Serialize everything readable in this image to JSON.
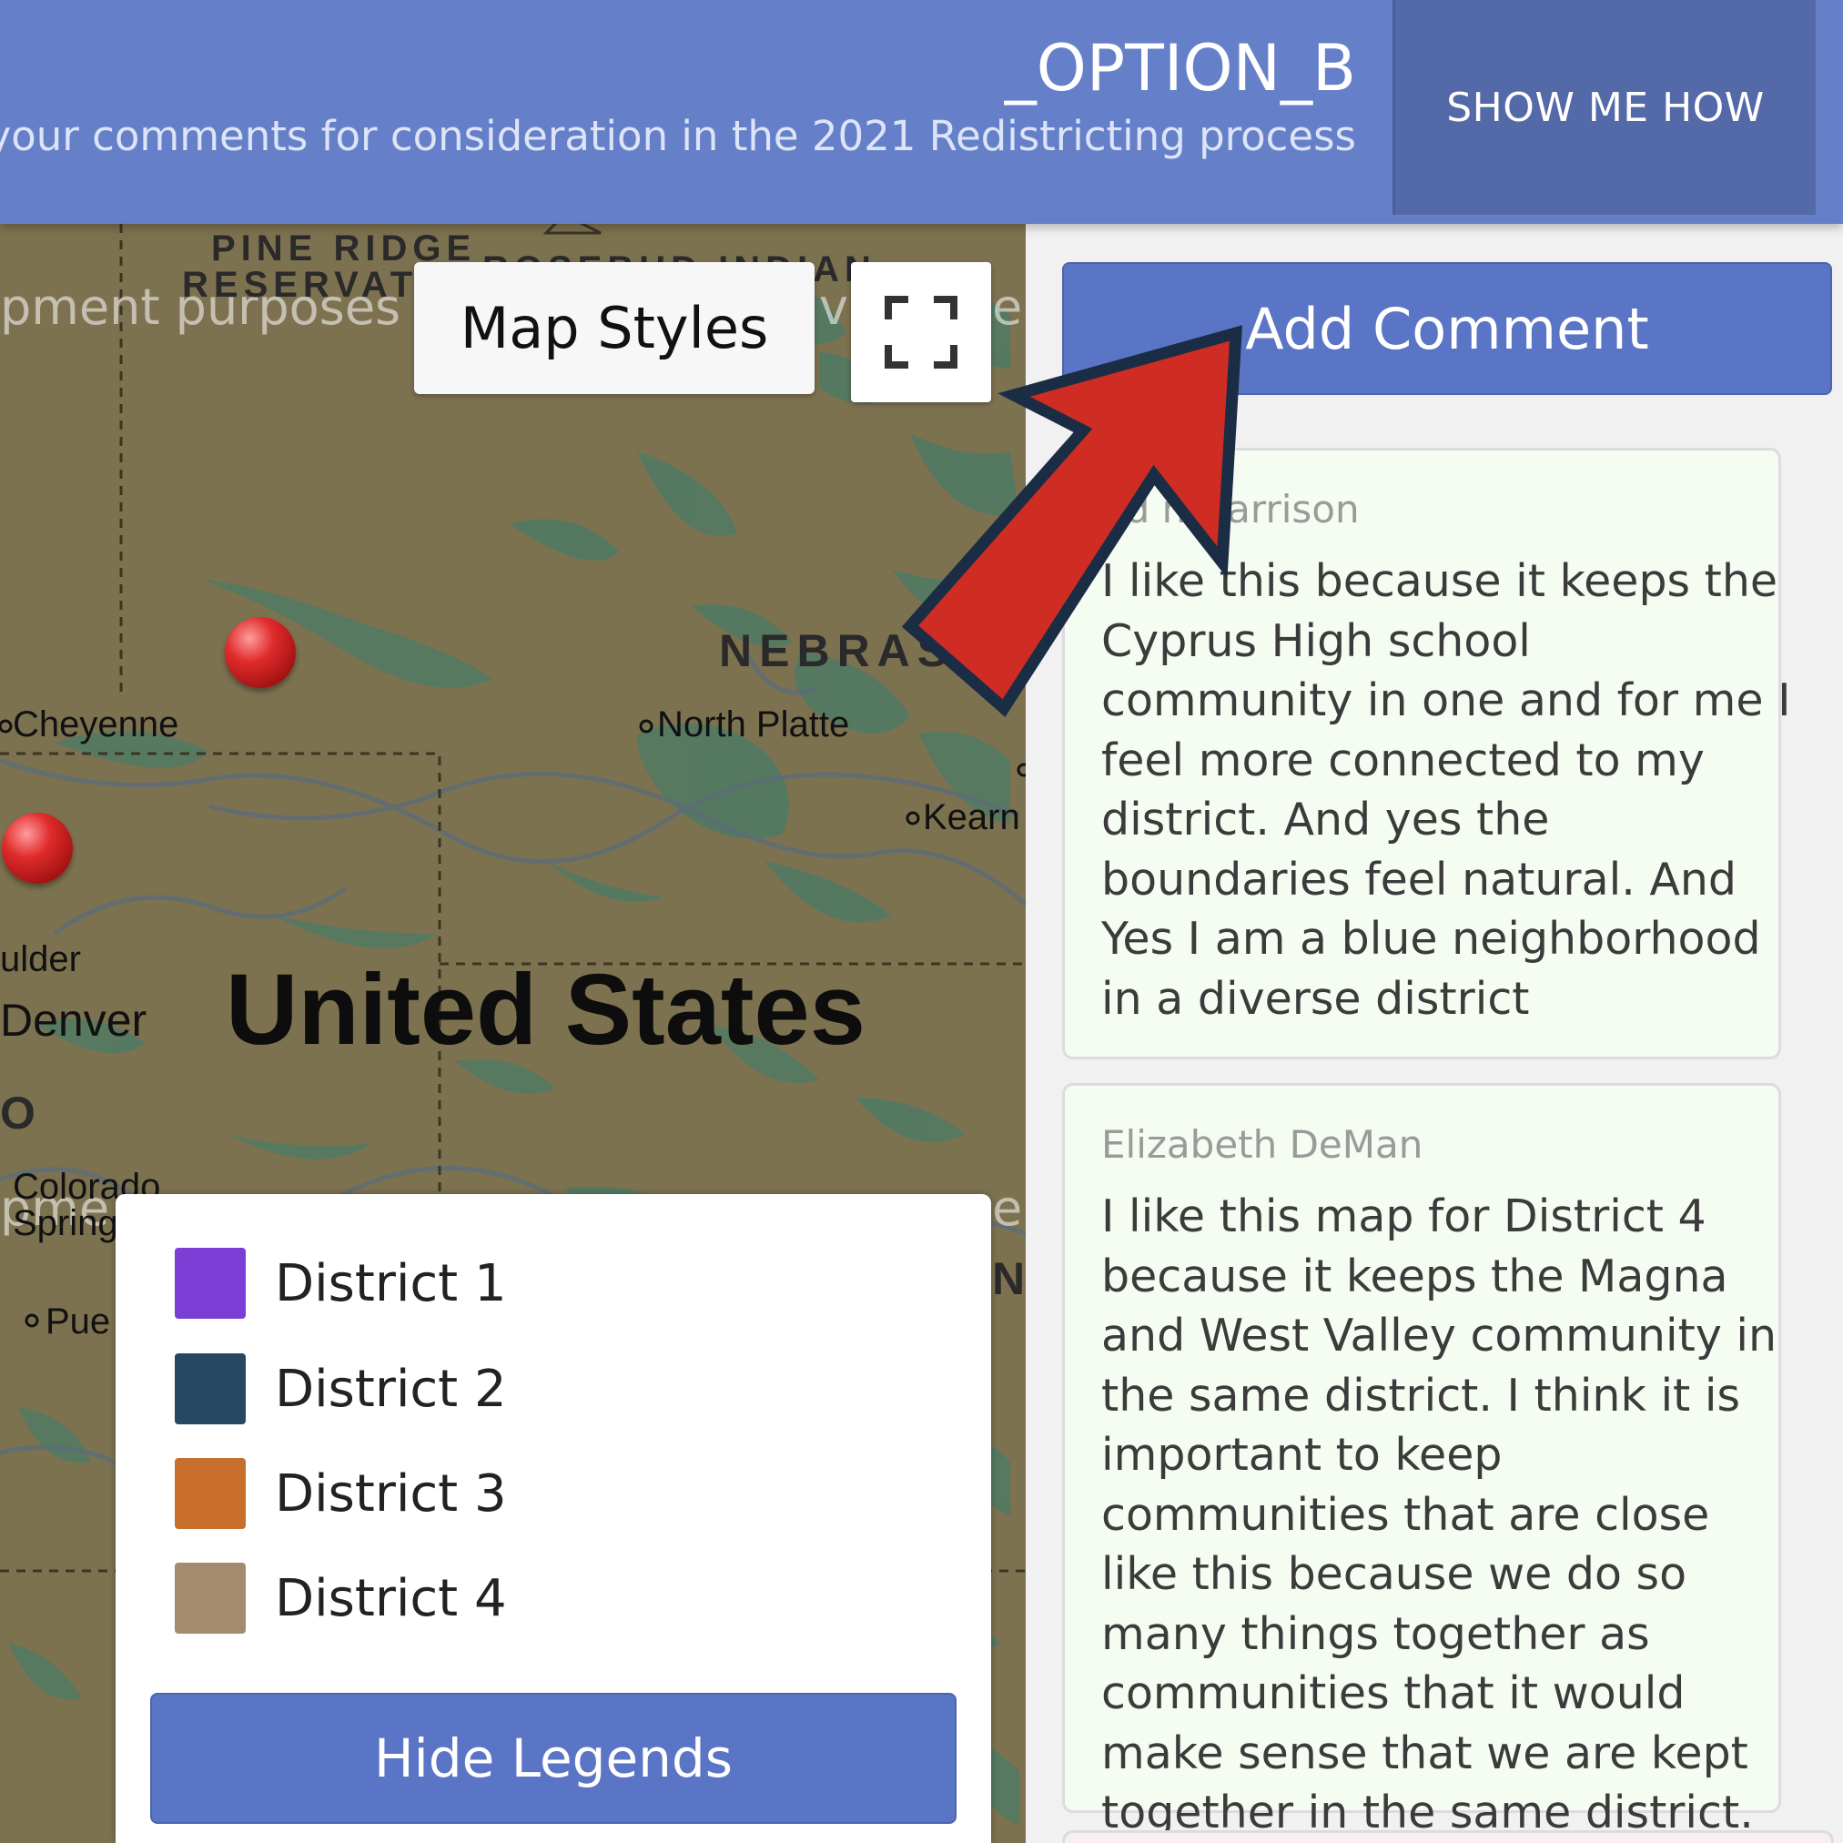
{
  "header": {
    "title": "_OPTION_B",
    "subtitle": "e your comments for consideration in the 2021 Redistricting process",
    "help_button": "SHOW ME HOW"
  },
  "map": {
    "map_styles_label": "Map Styles",
    "fullscreen_icon": "fullscreen-icon",
    "labels": {
      "pine_ridge_1": "PINE RIDGE",
      "pine_ridge_2": "RESERVATI",
      "rosebud": "ROSEBUD INDIAN",
      "nebraska": "NEBRAS",
      "cheyenne": "Cheyenne",
      "north_platte": "North Platte",
      "kearney": "Kearn",
      "boulder": "ulder",
      "denver": "Denver",
      "state_co": "O",
      "colorado_springs_1": "Colorado",
      "colorado_springs_2": "Spring",
      "pueblo": "Pue",
      "state_n": "N",
      "country": "United States"
    },
    "watermarks": {
      "top_left": "pment purposes c",
      "top_right": "ve",
      "top_edge": "en",
      "bottom_left": "pme",
      "bottom_right": "en"
    },
    "colors": {
      "land": "#7d7250",
      "vegetation": "#4f7a63",
      "marker": "#d42424"
    }
  },
  "legend": {
    "items": [
      {
        "label": "District 1",
        "color": "#7b3fd6"
      },
      {
        "label": "District 2",
        "color": "#264862"
      },
      {
        "label": "District 3",
        "color": "#c86f2e"
      },
      {
        "label": "District 4",
        "color": "#a48a6e"
      }
    ],
    "hide_button": "Hide Legends"
  },
  "sidebar": {
    "add_comment": "Add Comment",
    "comments": [
      {
        "author": "nd n Harrison",
        "text": "I like this because it keeps the Cyprus High school community in one and for me I feel more connected to my district. And yes the boundaries feel natural. And Yes I am a blue neighborhood in a diverse district"
      },
      {
        "author": "Elizabeth DeMan",
        "text": "I like this map for District 4 because it keeps the Magna and West Valley community in the same district. I think it is important to keep communities that are close like this because we do so many things together as communities that it would make sense that we are kept together in the same district."
      }
    ]
  },
  "annotation": {
    "arrow_icon": "red-arrow-icon",
    "arrow_color": "#cf2d24",
    "arrow_outline": "#1b2d44"
  }
}
